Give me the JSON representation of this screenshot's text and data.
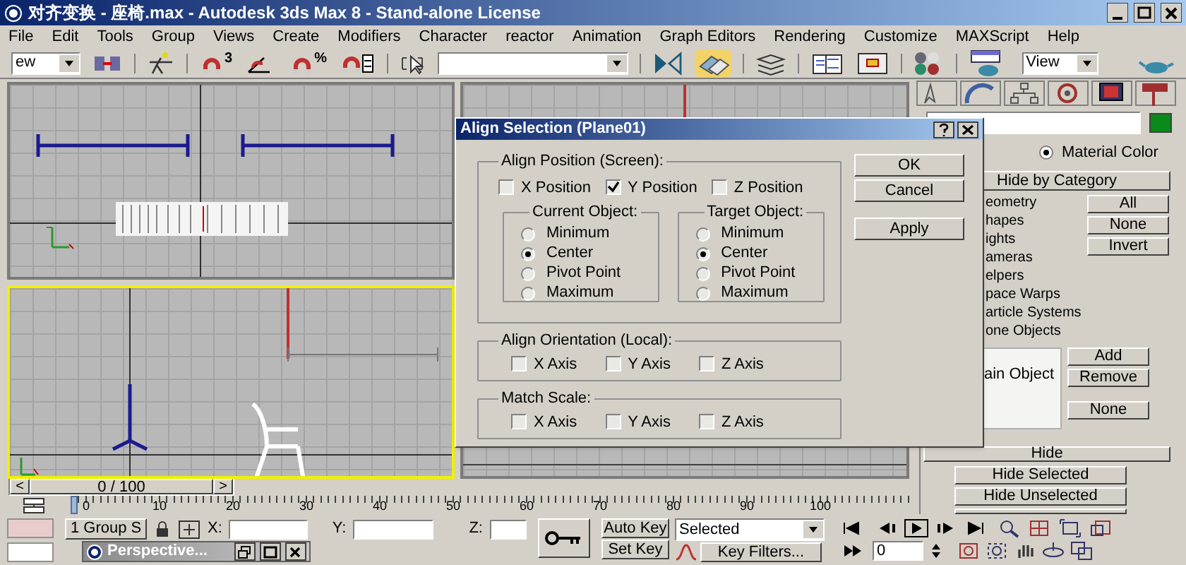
{
  "window": {
    "title": "对齐变换 - 座椅.max - Autodesk 3ds Max 8  - Stand-alone License"
  },
  "menu": [
    "File",
    "Edit",
    "Tools",
    "Group",
    "Views",
    "Create",
    "Modifiers",
    "Character",
    "reactor",
    "Animation",
    "Graph Editors",
    "Rendering",
    "Customize",
    "MAXScript",
    "Help"
  ],
  "toolbar": {
    "selection_filter": "ew",
    "snap_mode": "3",
    "percent_snap": "%",
    "reference_coordinate": "View",
    "align_active": true
  },
  "viewports": [
    {
      "selected": false
    },
    {
      "selected": false
    },
    {
      "selected": true
    },
    {
      "selected": false
    }
  ],
  "dialog": {
    "title": "Align Selection (Plane01)",
    "align_position": {
      "label": "Align Position (Screen):",
      "axes": [
        {
          "label": "X Position",
          "checked": false
        },
        {
          "label": "Y Position",
          "checked": true
        },
        {
          "label": "Z Position",
          "checked": false
        }
      ],
      "groups": [
        {
          "label": "Current Object:",
          "options": [
            {
              "label": "Minimum",
              "selected": false
            },
            {
              "label": "Center",
              "selected": true
            },
            {
              "label": "Pivot Point",
              "selected": false
            },
            {
              "label": "Maximum",
              "selected": false
            }
          ]
        },
        {
          "label": "Target Object:",
          "options": [
            {
              "label": "Minimum",
              "selected": false
            },
            {
              "label": "Center",
              "selected": true
            },
            {
              "label": "Pivot Point",
              "selected": false
            },
            {
              "label": "Maximum",
              "selected": false
            }
          ]
        }
      ]
    },
    "align_orientation": {
      "label": "Align Orientation (Local):",
      "axes": [
        {
          "label": "X Axis",
          "checked": false
        },
        {
          "label": "Y Axis",
          "checked": false
        },
        {
          "label": "Z Axis",
          "checked": false
        }
      ]
    },
    "match_scale": {
      "label": "Match Scale:",
      "axes": [
        {
          "label": "X Axis",
          "checked": false
        },
        {
          "label": "Y Axis",
          "checked": false
        },
        {
          "label": "Z Axis",
          "checked": false
        }
      ]
    },
    "buttons": [
      "OK",
      "Cancel",
      "Apply"
    ]
  },
  "command_panel": {
    "display_color": {
      "label": "Material Color",
      "selected": true
    },
    "hide_by_category": {
      "title": "Hide by Category",
      "categories": [
        "eometry",
        "hapes",
        "ights",
        "ameras",
        "elpers",
        "pace Warps",
        "article Systems",
        "one Objects"
      ],
      "buttons": [
        "All",
        "None",
        "Invert"
      ],
      "list_items": [
        "ain Object"
      ],
      "list_buttons": [
        "Add",
        "Remove",
        "None"
      ]
    },
    "hide": {
      "title": "Hide",
      "buttons": [
        "Hide Selected",
        "Hide Unselected"
      ]
    }
  },
  "time_slider": {
    "prev": "<",
    "label": "0 / 100",
    "next": ">"
  },
  "timeline": {
    "ticks": [
      "0",
      "10",
      "20",
      "30",
      "40",
      "50",
      "60",
      "70",
      "80",
      "90",
      "100"
    ]
  },
  "status": {
    "selection": "1 Group S",
    "x_label": "X:",
    "y_label": "Y:",
    "z_label": "Z:",
    "auto_key": "Auto Key",
    "set_key": "Set Key",
    "key_mode": "Selected",
    "key_filters": "Key Filters...",
    "frame": "0"
  },
  "minimized_window": {
    "title": "Perspective..."
  }
}
